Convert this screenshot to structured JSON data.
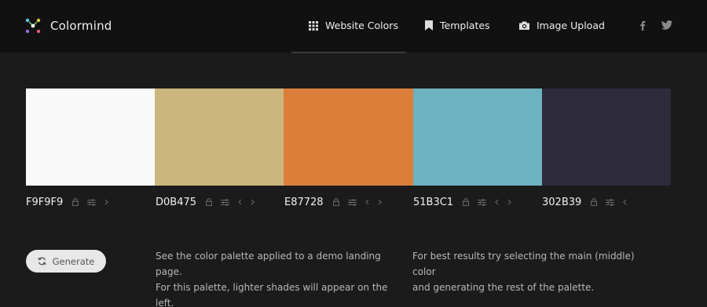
{
  "app": {
    "name": "Colormind"
  },
  "nav": [
    {
      "label": "Website Colors",
      "icon": "grid-icon"
    },
    {
      "label": "Templates",
      "icon": "bookmark-icon"
    },
    {
      "label": "Image Upload",
      "icon": "camera-icon"
    }
  ],
  "social": [
    "facebook-icon",
    "twitter-icon"
  ],
  "palette": [
    {
      "hex": "F9F9F9",
      "color": "#F9F9F9"
    },
    {
      "hex": "D0B475",
      "color": "#CBB77E"
    },
    {
      "hex": "E87728",
      "color": "#DB7E3A"
    },
    {
      "hex": "51B3C1",
      "color": "#6CB2C0"
    },
    {
      "hex": "302B39",
      "color": "#2D2A3A"
    }
  ],
  "generate": {
    "label": "Generate"
  },
  "info": {
    "left": [
      "See the color palette applied to a demo landing page.",
      "For this palette, lighter shades will appear on the left."
    ],
    "right": [
      "For best results try selecting the main (middle) color",
      "and generating the rest of the palette."
    ]
  }
}
